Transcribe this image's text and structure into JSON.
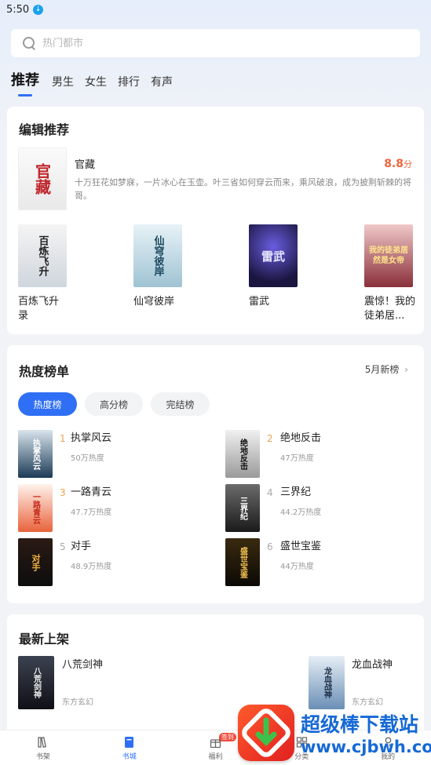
{
  "status_bar": {
    "time": "5:50",
    "download_glyph": "↓"
  },
  "search": {
    "placeholder": "热门都市"
  },
  "tabs": [
    {
      "label": "推荐",
      "active": true
    },
    {
      "label": "男生"
    },
    {
      "label": "女生"
    },
    {
      "label": "排行"
    },
    {
      "label": "有声"
    }
  ],
  "editor_picks": {
    "title": "编辑推荐",
    "featured": {
      "name": "官藏",
      "description": "十万狂花如梦寐，一片冰心在玉壶。叶三省如何穿云而来，乘风破浪，成为披荆斩棘的将哥。",
      "score": "8.8",
      "score_unit": "分",
      "cover_text": "官藏"
    },
    "books": [
      {
        "name": "百炼飞升录",
        "cover_text": "百炼飞升"
      },
      {
        "name": "仙穹彼岸",
        "cover_text": "仙穹彼岸"
      },
      {
        "name": "雷武",
        "cover_text": "雷武"
      },
      {
        "name": "震惊！我的徒弟居...",
        "cover_text": "我的徒弟居然是女帝"
      }
    ]
  },
  "hot_list": {
    "title": "热度榜单",
    "more_label": "5月新榜",
    "more_icon": "chevron-right-icon",
    "filters": [
      {
        "label": "热度榜",
        "active": true
      },
      {
        "label": "高分榜"
      },
      {
        "label": "完结榜"
      }
    ],
    "items": [
      {
        "rank": "1",
        "name": "执掌风云",
        "heat": "50万热度",
        "cover_text": "执掌风云"
      },
      {
        "rank": "2",
        "name": "绝地反击",
        "heat": "47万热度",
        "cover_text": "绝地反击"
      },
      {
        "rank": "3",
        "name": "一路青云",
        "heat": "47.7万热度",
        "cover_text": "一路青云"
      },
      {
        "rank": "4",
        "name": "三界纪",
        "heat": "44.2万热度",
        "cover_text": "三界纪"
      },
      {
        "rank": "5",
        "name": "对手",
        "heat": "48.9万热度",
        "cover_text": "对手"
      },
      {
        "rank": "6",
        "name": "盛世宝鉴",
        "heat": "44万热度",
        "cover_text": "盛世宝鉴"
      }
    ]
  },
  "new_arrivals": {
    "title": "最新上架",
    "items": [
      {
        "name": "八荒剑神",
        "category": "东方玄幻",
        "cover_text": "八荒剑神"
      },
      {
        "name": "龙血战神",
        "category": "东方玄幻",
        "cover_text": "龙血战神"
      }
    ]
  },
  "bottom_nav": [
    {
      "label": "书架",
      "icon": "bookshelf-icon"
    },
    {
      "label": "书城",
      "icon": "book-icon",
      "active": true
    },
    {
      "label": "福利",
      "icon": "gift-icon",
      "badge": "签到"
    },
    {
      "label": "分类",
      "icon": "grid-icon"
    },
    {
      "label": "我的",
      "icon": "user-icon"
    }
  ],
  "watermark": {
    "title": "超级棒下载站",
    "url": "www.cjbwh.com"
  },
  "colors": {
    "accent": "#2f6ff5",
    "score": "#f0643c",
    "rank_top": "#f0a050"
  }
}
